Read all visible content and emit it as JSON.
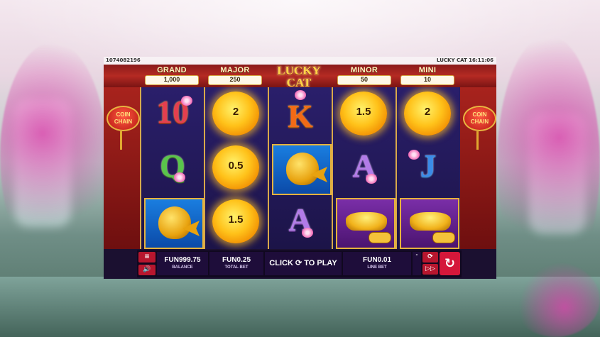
{
  "top_bar": {
    "session_id": "1074082196",
    "game_clock": "LUCKY CAT 16:11:06"
  },
  "logo": {
    "line1": "LUCKY",
    "line2": "CAT"
  },
  "jackpots": [
    {
      "name": "GRAND",
      "value": "1,000"
    },
    {
      "name": "MAJOR",
      "value": "250"
    },
    {
      "name": "MINOR",
      "value": "50"
    },
    {
      "name": "MINI",
      "value": "10"
    }
  ],
  "side_badges": {
    "left": "COIN CHAIN",
    "right": "COIN CHAIN"
  },
  "reels": [
    [
      {
        "type": "letter",
        "text": "10"
      },
      {
        "type": "letter",
        "text": "Q"
      },
      {
        "type": "fish",
        "name": "koi-fish"
      }
    ],
    [
      {
        "type": "coin",
        "text": "2"
      },
      {
        "type": "coin",
        "text": "0.5"
      },
      {
        "type": "coin",
        "text": "1.5"
      }
    ],
    [
      {
        "type": "letter",
        "text": "K"
      },
      {
        "type": "fish",
        "name": "koi-fish"
      },
      {
        "type": "letter",
        "text": "A"
      }
    ],
    [
      {
        "type": "coin",
        "text": "1.5"
      },
      {
        "type": "letter",
        "text": "A"
      },
      {
        "type": "ingot",
        "name": "gold-ingot"
      }
    ],
    [
      {
        "type": "coin",
        "text": "2"
      },
      {
        "type": "letter",
        "text": "J"
      },
      {
        "type": "ingot",
        "name": "gold-ingot"
      }
    ]
  ],
  "controls": {
    "menu_icon": "≡",
    "sound_icon": "🔊",
    "balance": {
      "value": "FUN999.75",
      "label": "BALANCE"
    },
    "total_bet": {
      "value": "FUN0.25",
      "label": "TOTAL BET"
    },
    "play_prompt": "CLICK ⟳ TO PLAY",
    "line_bet": {
      "value": "FUN0.01",
      "label": "LINE BET"
    },
    "bet_minus": "-",
    "autoplay_icon": "⟳",
    "turbo_icon": "▷▷",
    "spin_icon": "↻"
  },
  "colors": {
    "accent_red": "#d5173a",
    "gold": "#e6b23c",
    "reel_bg": "#271b5e"
  }
}
